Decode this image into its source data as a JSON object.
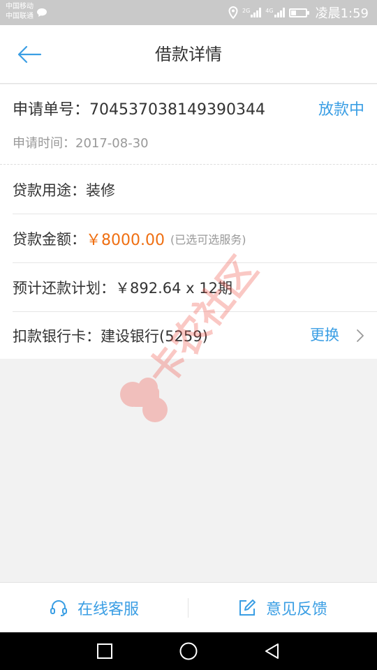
{
  "status_bar": {
    "carrier1": "中国移动",
    "carrier2": "中国联通",
    "net1": "2G",
    "net2": "4G",
    "time": "凌晨1:59",
    "icons": [
      "chat-bubble-icon",
      "location-icon",
      "signal-icon",
      "battery-icon"
    ]
  },
  "header": {
    "title": "借款详情",
    "back_icon": "back-arrow-icon"
  },
  "application": {
    "order_label": "申请单号：",
    "order_no": "704537038149390344",
    "status": "放款中",
    "time_label": "申请时间：",
    "time": "2017-08-30"
  },
  "details": {
    "purpose_label": "贷款用途：",
    "purpose": "装修",
    "amount_label": "贷款金额：",
    "amount": "￥8000.00",
    "amount_note": "(已选可选服务)",
    "plan_label": "预计还款计划：",
    "plan": "￥892.64 x 12期",
    "bank_label": "扣款银行卡：",
    "bank": "建设银行(5259)",
    "change": "更换"
  },
  "watermark": {
    "text": "卡农社区"
  },
  "actions": {
    "service": "在线客服",
    "service_icon": "headset-icon",
    "feedback": "意见反馈",
    "feedback_icon": "edit-icon"
  },
  "colors": {
    "accent": "#3a9ee4",
    "amount": "#ef6f12",
    "watermark": "#f05a50"
  }
}
